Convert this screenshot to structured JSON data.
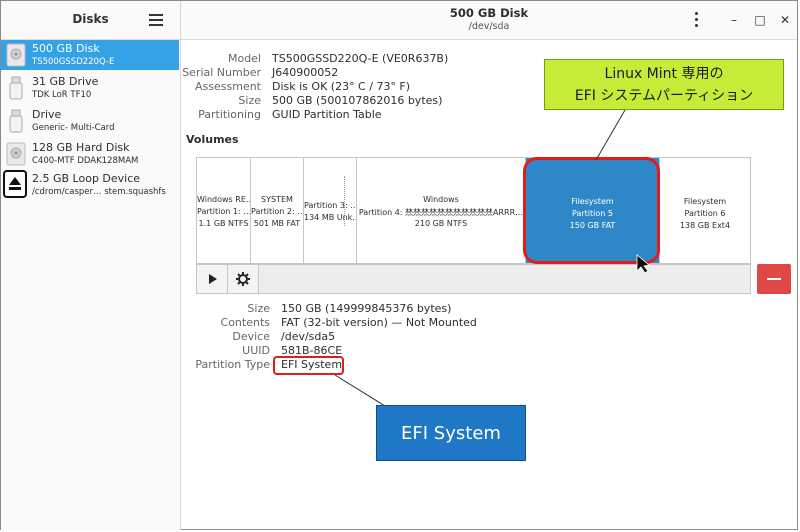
{
  "sidebar": {
    "title": "Disks",
    "items": [
      {
        "name": "500 GB Disk",
        "sub": "TS500GSSD220Q-E",
        "icon": "hard-disk-icon",
        "selected": true
      },
      {
        "name": "31 GB Drive",
        "sub": "TDK LoR TF10",
        "icon": "usb-drive-icon",
        "selected": false
      },
      {
        "name": "Drive",
        "sub": "Generic- Multi-Card",
        "icon": "usb-drive-icon",
        "selected": false
      },
      {
        "name": "128 GB Hard Disk",
        "sub": "C400-MTF DDAK128MAM",
        "icon": "hard-disk-icon",
        "selected": false
      },
      {
        "name": "2.5 GB Loop Device",
        "sub": "/cdrom/casper… stem.squashfs",
        "icon": "eject-icon",
        "selected": false
      }
    ]
  },
  "header": {
    "title": "500 GB Disk",
    "subtitle": "/dev/sda"
  },
  "disk_info": {
    "labels": [
      "Model",
      "Serial Number",
      "Assessment",
      "Size",
      "Partitioning"
    ],
    "values": [
      "TS500GSSD220Q-E (VE0R637B)",
      "J640900052",
      "Disk is OK (23° C / 73° F)",
      "500 GB (500107862016 bytes)",
      "GUID Partition Table"
    ]
  },
  "volumes": {
    "title": "Volumes",
    "partitions": [
      {
        "l1": "Windows RE…",
        "l2": "Partition 1: …",
        "l3": "1.1 GB NTFS"
      },
      {
        "l1": "SYSTEM",
        "l2": "Partition 2: …",
        "l3": "501 MB FAT"
      },
      {
        "l1": "",
        "l2": "Partition 3: …",
        "l3": "134 MB Unk…"
      },
      {
        "l1": "Windows",
        "l2": "Partition 4: 㷊㷊㷊㷊㷊㷊㷊㷊㷊㷊㷊ARRR…",
        "l3": "210 GB NTFS"
      },
      {
        "l1": "Filesystem",
        "l2": "Partition 5",
        "l3": "150 GB FAT"
      },
      {
        "l1": "Filesystem",
        "l2": "Partition 6",
        "l3": "138 GB Ext4"
      }
    ]
  },
  "partition_info": {
    "labels": [
      "Size",
      "Contents",
      "Device",
      "UUID",
      "Partition Type"
    ],
    "values": [
      "150 GB (149999845376 bytes)",
      "FAT (32-bit version) — Not Mounted",
      "/dev/sda5",
      "581B-86CE",
      "EFI System"
    ]
  },
  "callouts": {
    "green_line1": "Linux Mint 専用の",
    "green_line2": "EFI システムパーティション",
    "blue": "EFI System"
  },
  "colors": {
    "selection": "#35a2e6",
    "partition_selected": "#2e88c8",
    "delete_button": "#e04848",
    "highlight": "#e01c1c",
    "callout_green": "#c7ec37",
    "callout_blue": "#1f78c6"
  }
}
